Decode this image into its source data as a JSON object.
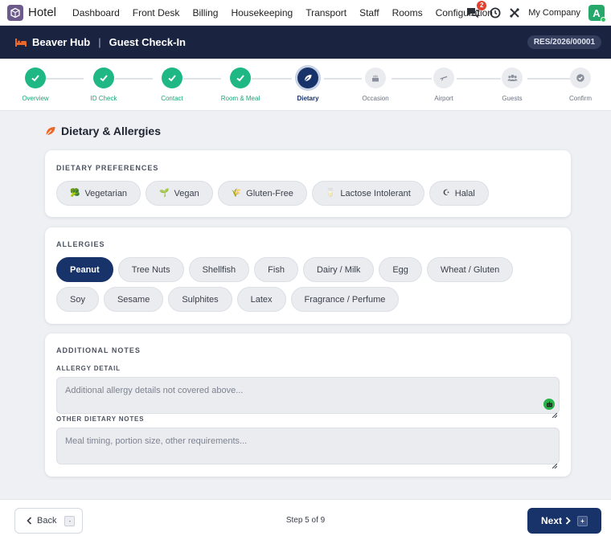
{
  "nav": {
    "app_name": "Hotel",
    "menu": [
      "Dashboard",
      "Front Desk",
      "Billing",
      "Housekeeping",
      "Transport",
      "Staff",
      "Rooms",
      "Configuration"
    ],
    "chat_badge": "2",
    "company": "My Company",
    "avatar_initial": "A"
  },
  "header": {
    "hub": "Beaver Hub",
    "separator": "|",
    "title": "Guest Check-In",
    "reservation": "RES/2026/00001"
  },
  "stepper": {
    "steps": [
      {
        "label": "Overview",
        "state": "done"
      },
      {
        "label": "ID Check",
        "state": "done"
      },
      {
        "label": "Contact",
        "state": "done"
      },
      {
        "label": "Room & Meal",
        "state": "done"
      },
      {
        "label": "Dietary",
        "state": "active"
      },
      {
        "label": "Occasion",
        "state": "todo"
      },
      {
        "label": "Airport",
        "state": "todo"
      },
      {
        "label": "Guests",
        "state": "todo"
      },
      {
        "label": "Confirm",
        "state": "todo"
      }
    ]
  },
  "section": {
    "title": "Dietary & Allergies"
  },
  "dietary": {
    "label": "DIETARY PREFERENCES",
    "options": [
      {
        "label": "Vegetarian",
        "glyph": "🥦"
      },
      {
        "label": "Vegan",
        "glyph": "🌱"
      },
      {
        "label": "Gluten-Free",
        "glyph": "🌾"
      },
      {
        "label": "Lactose Intolerant",
        "glyph": "🥛"
      },
      {
        "label": "Halal",
        "glyph": "☪"
      }
    ]
  },
  "allergies": {
    "label": "ALLERGIES",
    "options": [
      "Peanut",
      "Tree Nuts",
      "Shellfish",
      "Fish",
      "Dairy / Milk",
      "Egg",
      "Wheat / Gluten",
      "Soy",
      "Sesame",
      "Sulphites",
      "Latex",
      "Fragrance / Perfume"
    ],
    "selected": "Peanut"
  },
  "notes": {
    "label": "ADDITIONAL NOTES",
    "allergy_detail_label": "ALLERGY DETAIL",
    "allergy_detail_placeholder": "Additional allergy details not covered above...",
    "allergy_detail_value": "",
    "other_label": "OTHER DIETARY NOTES",
    "other_placeholder": "Meal timing, portion size, other requirements...",
    "other_value": ""
  },
  "footer": {
    "back_label": "Back",
    "back_key": "-",
    "step_text": "Step 5 of 9",
    "next_label": "Next",
    "next_key": "+"
  },
  "colors": {
    "primary": "#17336a",
    "done": "#1fb885",
    "header_bg": "#1a2340",
    "accent_orange": "#e8692a"
  }
}
